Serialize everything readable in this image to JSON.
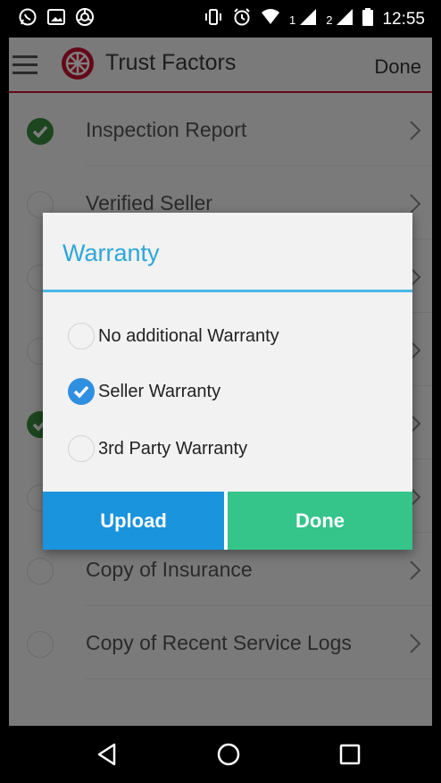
{
  "status_bar": {
    "sim1": "1",
    "sim2": "2",
    "time": "12:55",
    "icons": [
      "whatsapp-icon",
      "image-icon",
      "chrome-icon",
      "vibrate-icon",
      "alarm-icon",
      "wifi-icon",
      "signal-icon",
      "signal-icon",
      "battery-icon"
    ]
  },
  "app_bar": {
    "title": "Trust Factors",
    "done_label": "Done",
    "accent": "#c8102e"
  },
  "list": {
    "items": [
      {
        "label": "Inspection Report",
        "checked": true
      },
      {
        "label": "Verified Seller",
        "checked": false
      },
      {
        "label": "",
        "checked": false
      },
      {
        "label": "",
        "checked": false
      },
      {
        "label": "",
        "checked": true
      },
      {
        "label": "",
        "checked": false
      },
      {
        "label": "Copy of Insurance",
        "checked": false
      },
      {
        "label": "Copy of Recent Service Logs",
        "checked": false
      }
    ]
  },
  "dialog": {
    "title": "Warranty",
    "options": [
      {
        "label": "No additional Warranty",
        "selected": false
      },
      {
        "label": "Seller Warranty",
        "selected": true
      },
      {
        "label": "3rd Party Warranty",
        "selected": false
      }
    ],
    "upload_label": "Upload",
    "done_label": "Done",
    "colors": {
      "title": "#2ea7d8",
      "upload": "#1a94dc",
      "done": "#35c48a",
      "radio_on": "#2f8fe0"
    }
  },
  "nav_bar": {
    "icons": [
      "back-icon",
      "home-icon",
      "recents-icon"
    ]
  }
}
